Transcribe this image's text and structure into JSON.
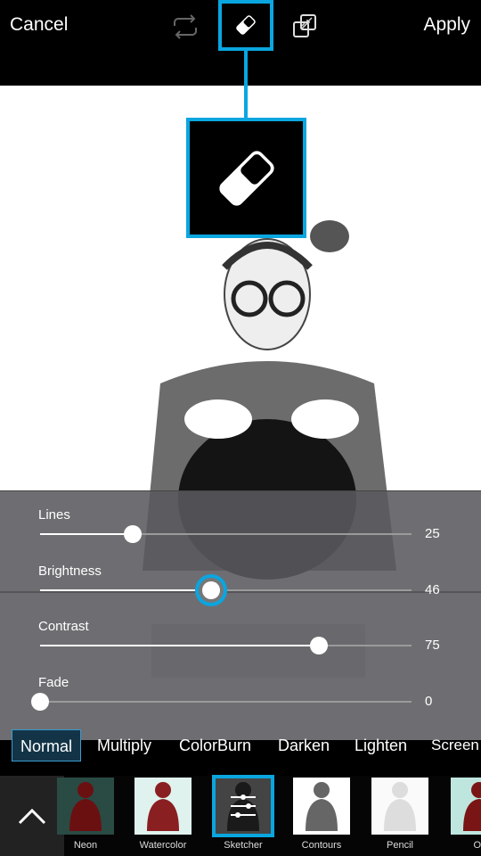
{
  "topbar": {
    "cancel": "Cancel",
    "apply": "Apply",
    "icons": [
      "swap-icon",
      "eraser-icon",
      "blend-layers-icon"
    ]
  },
  "accent": "#0aa6e0",
  "sliders": [
    {
      "label": "Lines",
      "value": 25
    },
    {
      "label": "Brightness",
      "value": 46
    },
    {
      "label": "Contrast",
      "value": 75
    },
    {
      "label": "Fade",
      "value": 0
    }
  ],
  "blend_modes": {
    "items": [
      "Normal",
      "Multiply",
      "ColorBurn",
      "Darken",
      "Lighten",
      "Screen"
    ],
    "selected": "Normal"
  },
  "effects": {
    "items": [
      "Neon",
      "Watercolor",
      "Sketcher",
      "Contours",
      "Pencil",
      "O"
    ],
    "selected": "Sketcher"
  }
}
